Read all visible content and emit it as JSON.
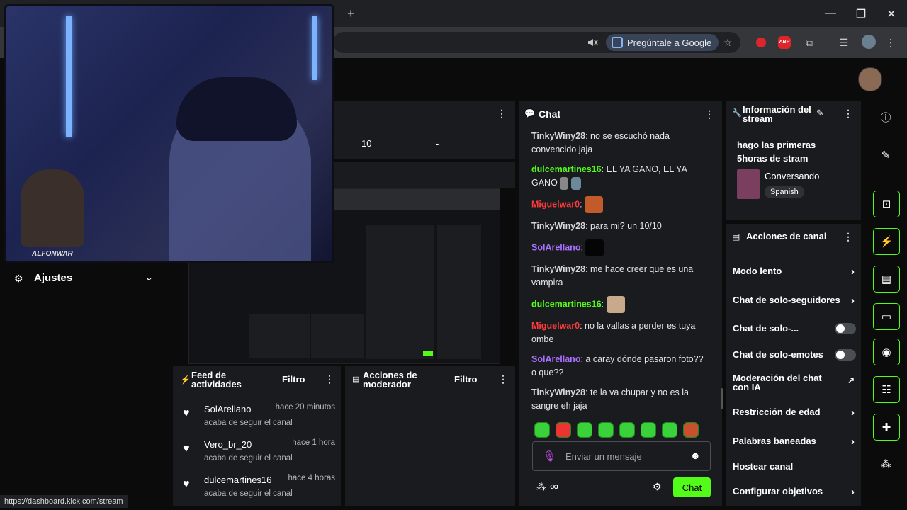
{
  "browser": {
    "new_tab_symbol": "+",
    "google_button_label": "Pregúntale a Google",
    "window_controls": {
      "minimize": "—",
      "maximize": "❐",
      "close": "✕"
    },
    "extension_badge": "ABP"
  },
  "stream_info_panel": {
    "title": "Información del stream",
    "stream_title": "hago las primeras 5horas de stram",
    "category": "Conversando",
    "language": "Spanish"
  },
  "chat": {
    "title": "Chat",
    "messages": [
      {
        "user": "TinkyWiny28",
        "user_color": "#d9d9d9",
        "text": "no se escuchó nada convencido jaja"
      },
      {
        "user": "dulcemartines16",
        "user_color": "#53fc18",
        "text": "EL YA GANO, EL YA GANO"
      },
      {
        "user": "Miguelwar0",
        "user_color": "#ff3b3b",
        "text": ""
      },
      {
        "user": "TinkyWiny28",
        "user_color": "#d9d9d9",
        "text": "para mi? un 10/10"
      },
      {
        "user": "SolArellano",
        "user_color": "#a970ff",
        "text": ""
      },
      {
        "user": "TinkyWiny28",
        "user_color": "#d9d9d9",
        "text": "me hace creer que es una vampira"
      },
      {
        "user": "dulcemartines16",
        "user_color": "#53fc18",
        "text": ""
      },
      {
        "user": "Miguelwar0",
        "user_color": "#ff3b3b",
        "text": "no la vallas a perder es tuya ombe"
      },
      {
        "user": "SolArellano",
        "user_color": "#a970ff",
        "text": "a caray dónde pasaron foto?? o que??"
      },
      {
        "user": "TinkyWiny28",
        "user_color": "#d9d9d9",
        "text": "te la va chupar y no es la sangre eh jaja"
      }
    ],
    "input_placeholder": "Enviar un mensaje",
    "send_label": "Chat",
    "infinity_symbol": "∞"
  },
  "settings": {
    "label": "Ajustes"
  },
  "top_panel": {
    "value_a": "10",
    "value_b": "-"
  },
  "activity_feed": {
    "title": "Feed de actividades",
    "filter_label": "Filtro",
    "items": [
      {
        "name": "SolArellano",
        "time": "hace 20 minutos",
        "action": "acaba de seguir el canal"
      },
      {
        "name": "Vero_br_20",
        "time": "hace 1 hora",
        "action": "acaba de seguir el canal"
      },
      {
        "name": "dulcemartines16",
        "time": "hace 4 horas",
        "action": "acaba de seguir el canal"
      }
    ]
  },
  "mod_actions": {
    "title": "Acciones de moderador",
    "filter_label": "Filtro"
  },
  "channel_actions": {
    "title": "Acciones de canal",
    "items": [
      {
        "label": "Modo lento",
        "control": "chevron"
      },
      {
        "label": "Chat de solo-seguidores",
        "control": "chevron"
      },
      {
        "label": "Chat de solo-...",
        "control": "toggle"
      },
      {
        "label": "Chat de solo-emotes",
        "control": "toggle"
      },
      {
        "label": "Moderación del chat con IA",
        "control": "external"
      },
      {
        "label": "Restricción de edad",
        "control": "chevron"
      },
      {
        "label": "Palabras baneadas",
        "control": "chevron"
      },
      {
        "label": "Hostear canal",
        "control": "none"
      },
      {
        "label": "Configurar objetivos",
        "control": "chevron"
      }
    ]
  },
  "webcam": {
    "overlay_name": "ALFONWAR"
  },
  "status_url": "https://dashboard.kick.com/stream",
  "colors": {
    "accent": "#53fc18",
    "panel": "#191b1f",
    "background": "#0b0b0c"
  }
}
